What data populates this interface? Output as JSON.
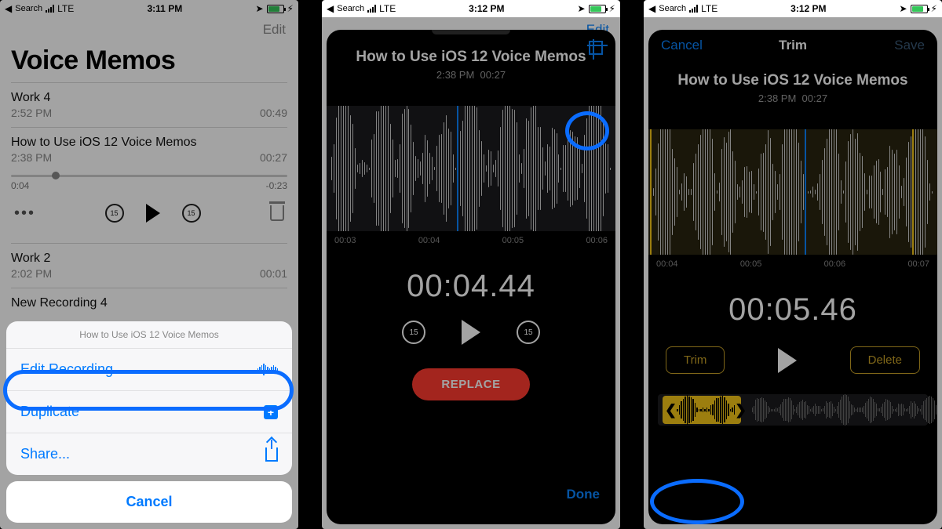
{
  "status": {
    "search": "Search",
    "carrier": "LTE",
    "time1": "3:11 PM",
    "time2": "3:12 PM",
    "time3": "3:12 PM"
  },
  "screen1": {
    "edit": "Edit",
    "title": "Voice Memos",
    "memos": [
      {
        "title": "Work 4",
        "time": "2:52 PM",
        "dur": "00:49"
      },
      {
        "title": "How to Use iOS 12 Voice Memos",
        "time": "2:38 PM",
        "dur": "00:27"
      },
      {
        "title": "Work 2",
        "time": "2:02 PM",
        "dur": "00:01"
      },
      {
        "title": "New Recording 4",
        "time": "",
        "dur": ""
      }
    ],
    "scrub_left": "0:04",
    "scrub_right": "-0:23",
    "skip_back": "15",
    "skip_fwd": "15",
    "sheet_title": "How to Use iOS 12 Voice Memos",
    "sheet_edit": "Edit Recording",
    "sheet_dup": "Duplicate",
    "sheet_share": "Share...",
    "sheet_cancel": "Cancel"
  },
  "screen2": {
    "edit": "Edit",
    "title": "How to Use iOS 12 Voice Memos",
    "subtitle_time": "2:38 PM",
    "subtitle_dur": "00:27",
    "ticks": [
      "00:03",
      "00:04",
      "00:05",
      "00:06"
    ],
    "big_time": "00:04.44",
    "skip": "15",
    "replace": "REPLACE",
    "done": "Done"
  },
  "screen3": {
    "cancel": "Cancel",
    "nav_title": "Trim",
    "save": "Save",
    "title": "How to Use iOS 12 Voice Memos",
    "subtitle_time": "2:38 PM",
    "subtitle_dur": "00:27",
    "ticks": [
      "00:04",
      "00:05",
      "00:06",
      "00:07"
    ],
    "big_time": "00:05.46",
    "trim_btn": "Trim",
    "delete_btn": "Delete"
  }
}
